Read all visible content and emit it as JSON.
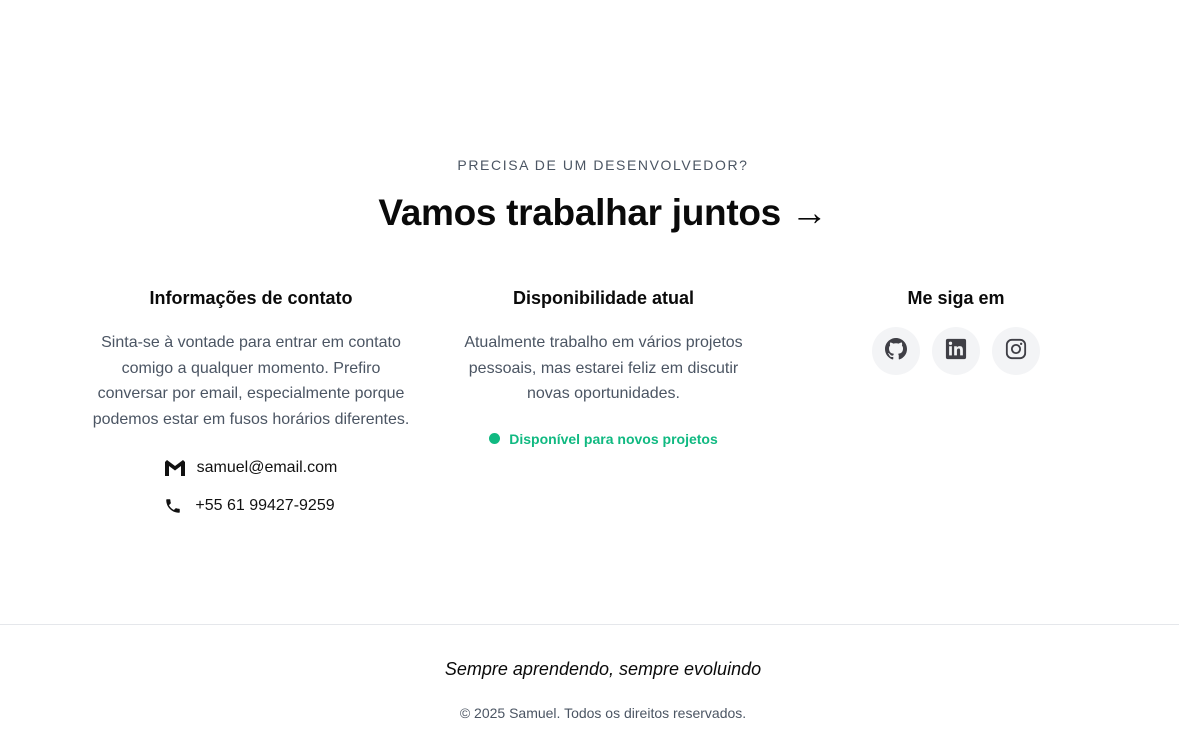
{
  "hero": {
    "eyebrow": "PRECISA DE UM DESENVOLVEDOR?",
    "headline": "Vamos trabalhar juntos →"
  },
  "contact": {
    "title": "Informações de contato",
    "description": "Sinta-se à vontade para entrar em contato comigo a qualquer momento. Prefiro conversar por email, especialmente porque podemos estar em fusos horários diferentes.",
    "email": "samuel@email.com",
    "phone": "+55 61 99427-9259",
    "email_icon": "gmail-icon",
    "phone_icon": "phone-icon"
  },
  "availability": {
    "title": "Disponibilidade atual",
    "description": "Atualmente trabalho em vários projetos pessoais, mas estarei feliz em discutir novas oportunidades.",
    "status": "Disponível para novos projetos",
    "status_color": "#10b981"
  },
  "social": {
    "title": "Me siga em",
    "links": [
      {
        "icon": "github-icon"
      },
      {
        "icon": "linkedin-icon"
      },
      {
        "icon": "instagram-icon"
      }
    ]
  },
  "footer": {
    "motto": "Sempre aprendendo, sempre evoluindo",
    "copyright": "© 2025 Samuel. Todos os direitos reservados."
  }
}
